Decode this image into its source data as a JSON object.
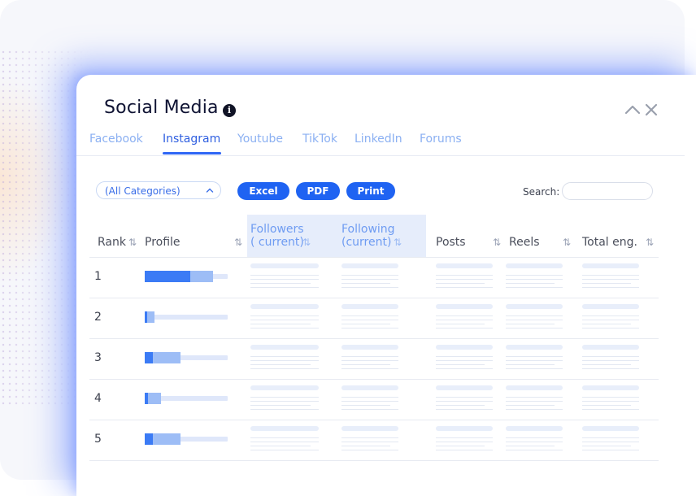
{
  "panel": {
    "title": "Social Media",
    "info_icon": "i",
    "collapse_icon": "chevron-up-icon",
    "close_icon": "close-icon"
  },
  "tabs": [
    {
      "label": "Facebook",
      "active": false
    },
    {
      "label": "Instagram",
      "active": true
    },
    {
      "label": "Youtube",
      "active": false
    },
    {
      "label": "TikTok",
      "active": false
    },
    {
      "label": "LinkedIn",
      "active": false
    },
    {
      "label": "Forums",
      "active": false
    }
  ],
  "toolbar": {
    "category_select": "(All Categories)",
    "excel": "Excel",
    "pdf": "PDF",
    "print": "Print",
    "search_label": "Search:",
    "search_value": ""
  },
  "table": {
    "columns": {
      "rank": "Rank",
      "profile": "Profile",
      "followers_line1": "Followers",
      "followers_line2": "( current)",
      "following_line1": "Following",
      "following_line2": "(current)",
      "posts": "Posts",
      "reels": "Reels",
      "total": "Total eng."
    },
    "sort_icon": "⇅",
    "rows": [
      {
        "rank": "1",
        "primary_level": 0.55,
        "secondary_level": 0.82
      },
      {
        "rank": "2",
        "primary_level": 0.02,
        "secondary_level": 0.12
      },
      {
        "rank": "3",
        "primary_level": 0.1,
        "secondary_level": 0.43
      },
      {
        "rank": "4",
        "primary_level": 0.04,
        "secondary_level": 0.2
      },
      {
        "rank": "5",
        "primary_level": 0.1,
        "secondary_level": 0.43
      }
    ]
  },
  "colors": {
    "accent": "#1f63f2",
    "bar_primary": "#3b7bf5",
    "bar_secondary": "#9dbdf6",
    "bar_track": "#dfe7fa",
    "highlight_column": "#e6edfb"
  }
}
